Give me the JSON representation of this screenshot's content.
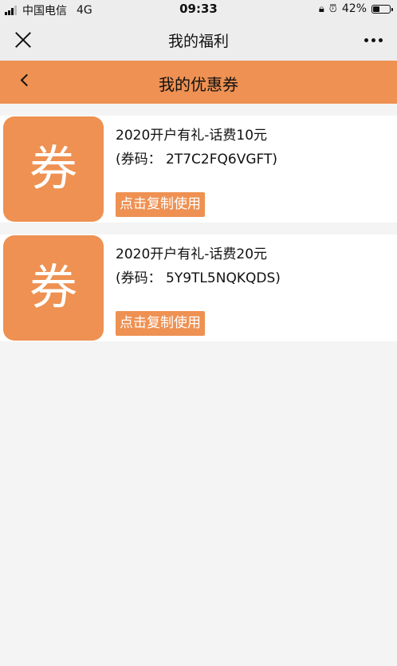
{
  "status_bar": {
    "carrier": "中国电信",
    "network": "4G",
    "time": "09:33",
    "battery": "42%"
  },
  "title_bar": {
    "title": "我的福利"
  },
  "header": {
    "title": "我的优惠券"
  },
  "coupons": [
    {
      "badge": "券",
      "title": "2020开户有礼-话费10元",
      "code": "(券码：  2T7C2FQ6VGFT)",
      "button": "点击复制使用"
    },
    {
      "badge": "券",
      "title": "2020开户有礼-话费20元",
      "code": "(券码：  5Y9TL5NQKQDS)",
      "button": "点击复制使用"
    }
  ],
  "colors": {
    "accent": "#ee9152",
    "background": "#f4f4f4",
    "bar": "#ededed"
  }
}
